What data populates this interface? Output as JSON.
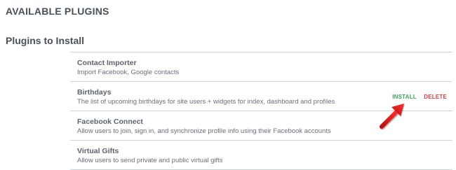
{
  "page": {
    "title": "AVAILABLE PLUGINS"
  },
  "section": {
    "title": "Plugins to Install"
  },
  "plugins": [
    {
      "name": "Contact Importer",
      "description": "Import Facebook, Google contacts"
    },
    {
      "name": "Birthdays",
      "description": "The list of upcoming birthdays for site users + widgets for index, dashboard and profiles",
      "actions": {
        "install_label": "INSTALL",
        "delete_label": "DELETE"
      }
    },
    {
      "name": "Facebook Connect",
      "description": "Allow users to join, sign in, and synchronize profile info using their Facebook accounts"
    },
    {
      "name": "Virtual Gifts",
      "description": "Allow users to send private and public virtual gifts"
    }
  ],
  "colors": {
    "install": "#3aa55a",
    "delete": "#d93c3c",
    "annotation_arrow": "#e01b1b"
  },
  "icons": {
    "annotation": "red-pointer-arrow-icon"
  }
}
